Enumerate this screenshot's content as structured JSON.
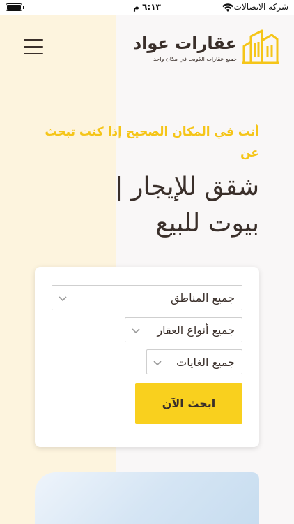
{
  "status_bar": {
    "time": "٦:١٣ م",
    "carrier": "شركة الاتصالات"
  },
  "header": {
    "logo_title": "عقارات عواد",
    "logo_subtitle": "جميع عقارات الكويت في مكان واحد"
  },
  "hero": {
    "tagline": "أنت في المكان الصحيح إذا كنت تبحث عن",
    "headline_line1": "شقق للإيجار |",
    "headline_line2": "بيوت للبيع"
  },
  "search": {
    "area_select": "جميع المناطق",
    "type_select": "جميع أنواع العقار",
    "purpose_select": "جميع الغايات",
    "submit_label": "ابحث الآن"
  },
  "colors": {
    "accent": "#f9d01e",
    "tagline": "#f5c518",
    "text": "#3a2f2a"
  }
}
